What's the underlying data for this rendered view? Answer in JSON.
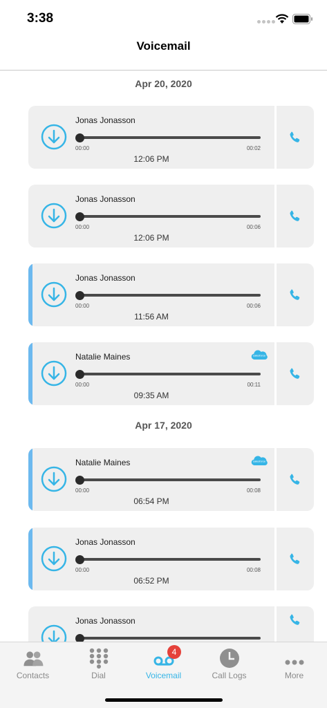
{
  "status_bar": {
    "time": "3:38"
  },
  "nav": {
    "title": "Voicemail"
  },
  "groups": [
    {
      "date": "Apr 20, 2020"
    },
    {
      "date": "Apr 17, 2020"
    }
  ],
  "voicemails": [
    {
      "caller": "Jonas Jonasson",
      "start": "00:00",
      "duration": "00:02",
      "time": "12:06 PM",
      "unread": false,
      "salesforce": false
    },
    {
      "caller": "Jonas Jonasson",
      "start": "00:00",
      "duration": "00:06",
      "time": "12:06 PM",
      "unread": false,
      "salesforce": false
    },
    {
      "caller": "Jonas Jonasson",
      "start": "00:00",
      "duration": "00:06",
      "time": "11:56 AM",
      "unread": true,
      "salesforce": false
    },
    {
      "caller": "Natalie Maines",
      "start": "00:00",
      "duration": "00:11",
      "time": "09:35 AM",
      "unread": true,
      "salesforce": true
    },
    {
      "caller": "Natalie Maines",
      "start": "00:00",
      "duration": "00:08",
      "time": "06:54 PM",
      "unread": true,
      "salesforce": true
    },
    {
      "caller": "Jonas Jonasson",
      "start": "00:00",
      "duration": "00:08",
      "time": "06:52 PM",
      "unread": true,
      "salesforce": false
    },
    {
      "caller": "Jonas Jonasson",
      "start": "",
      "duration": "",
      "time": "",
      "unread": false,
      "salesforce": false
    }
  ],
  "tabs": [
    {
      "label": "Contacts",
      "icon": "contacts-icon",
      "active": false
    },
    {
      "label": "Dial",
      "icon": "dialpad-icon",
      "active": false
    },
    {
      "label": "Voicemail",
      "icon": "voicemail-icon",
      "active": true,
      "badge": "4"
    },
    {
      "label": "Call Logs",
      "icon": "clock-icon",
      "active": false
    },
    {
      "label": "More",
      "icon": "more-icon",
      "active": false
    }
  ],
  "colors": {
    "accent": "#36b5e6",
    "unread_bar": "#6cb9ef",
    "badge": "#e5413a",
    "card_bg": "#efefef"
  }
}
